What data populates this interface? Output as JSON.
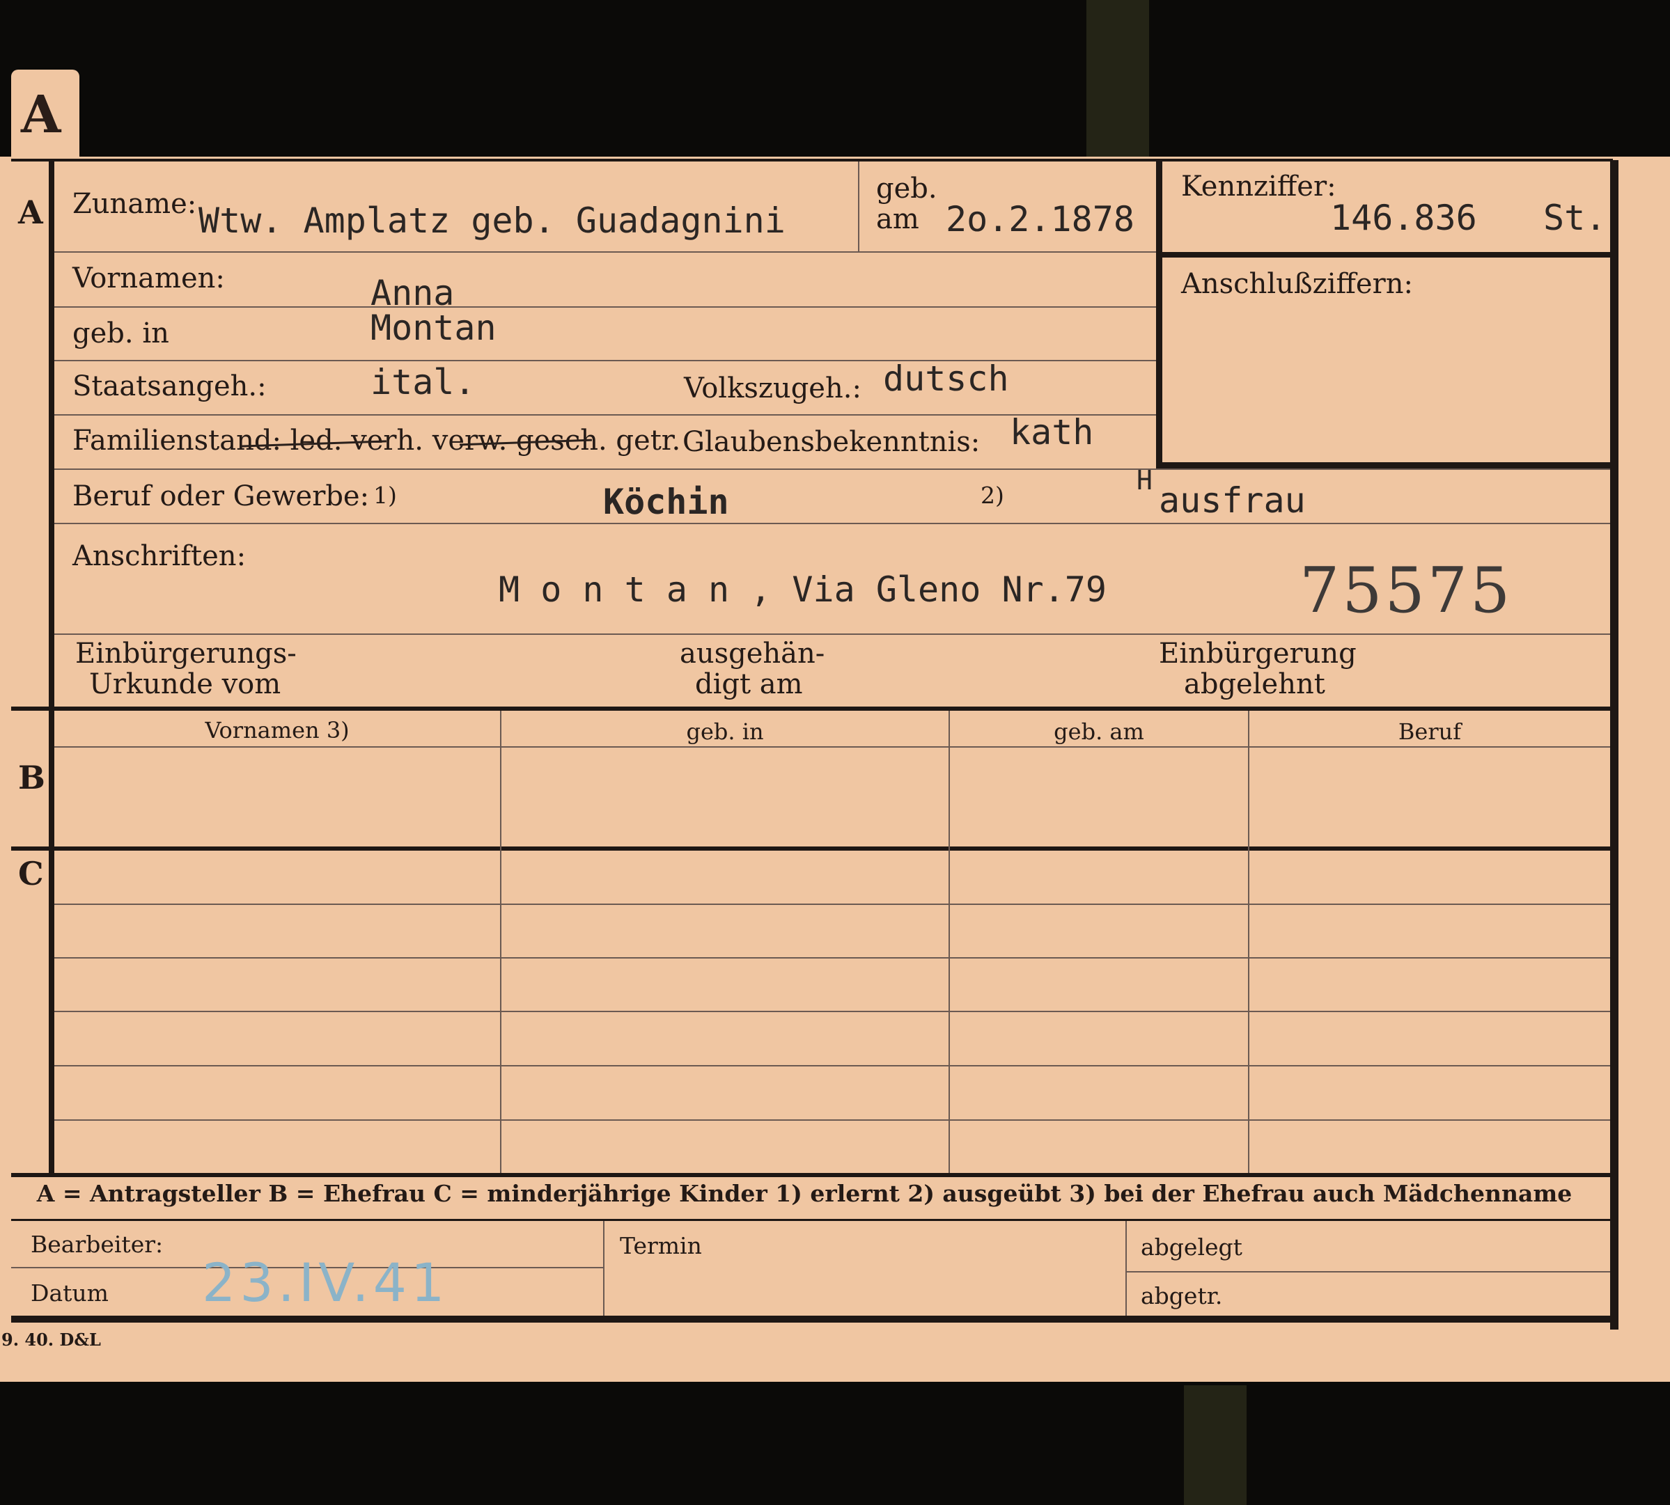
{
  "card": {
    "tab_letter": "A",
    "sections": {
      "a": "A",
      "b": "B",
      "c": "C"
    },
    "labels": {
      "zuname": "Zuname:",
      "geb": "geb.",
      "am": "am",
      "kennziffer": "Kennziffer:",
      "anschlussziffern": "Anschlußziffern:",
      "vornamen": "Vornamen:",
      "geb_in": "geb. in",
      "staatsangeh": "Staatsangeh.:",
      "volkszugeh": "Volkszugeh.:",
      "familienstand": "Familienstand: led. verh. verw. gesch. getr.",
      "glaubensbekenntnis": "Glaubensbekenntnis:",
      "beruf": "Beruf oder Gewerbe:",
      "fn1": "1)",
      "fn2": "2)",
      "anschriften": "Anschriften:",
      "einbuergerungsurkunde_1": "Einbürgerungs-",
      "einbuergerungsurkunde_2": "Urkunde vom",
      "ausgehaendigt_1": "ausgehän-",
      "ausgehaendigt_2": "digt am",
      "einbuergerung_abgelehnt_1": "Einbürgerung",
      "einbuergerung_abgelehnt_2": "abgelehnt"
    },
    "values": {
      "zuname": "Wtw. Amplatz  geb. Guadagnini",
      "geb_am": "2o.2.1878",
      "kennziffer": "146.836",
      "kennziffer_suffix": "St.",
      "vornamen": "Anna",
      "geb_in": "Montan",
      "staatsangeh": "ital.",
      "volkszugeh": "dutsch",
      "glaubensbekenntnis": "kath",
      "beruf_1": "Köchin",
      "beruf_2_prefix": "H",
      "beruf_2": "ausfrau",
      "anschrift": "M o n t a n , Via Gleno Nr.79",
      "stamp_number": "75575"
    },
    "table_headers": [
      "Vornamen 3)",
      "geb. in",
      "geb. am",
      "Beruf"
    ],
    "legend": "A = Antragsteller   B = Ehefrau   C = minderjährige Kinder   1) erlernt   2) ausgeübt   3) bei der Ehefrau auch Mädchenname",
    "footer": {
      "bearbeiter": "Bearbeiter:",
      "datum": "Datum",
      "datum_value": "23.IV.41",
      "termin": "Termin",
      "abgelegt": "abgelegt",
      "abgetr": "abgetr."
    },
    "print_code": "9. 40. D&L"
  }
}
